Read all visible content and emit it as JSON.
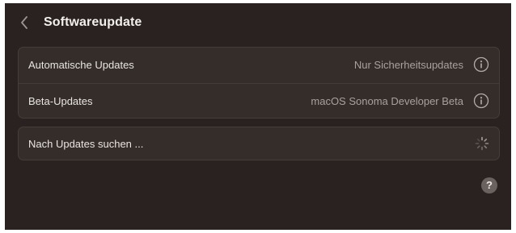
{
  "header": {
    "title": "Softwareupdate",
    "back_icon": "chevron-left-icon"
  },
  "settings": {
    "rows": [
      {
        "label": "Automatische Updates",
        "value": "Nur Sicherheitsupdates",
        "icon": "info-icon"
      },
      {
        "label": "Beta-Updates",
        "value": "macOS Sonoma Developer Beta",
        "icon": "info-icon"
      }
    ]
  },
  "check": {
    "label": "Nach Updates suchen ...",
    "icon": "spinner-icon"
  },
  "help": {
    "label": "?"
  },
  "colors": {
    "background": "#2a2220",
    "group_background": "#352d2a",
    "text_primary": "#e9e5e2",
    "text_secondary": "#a8a19d"
  }
}
